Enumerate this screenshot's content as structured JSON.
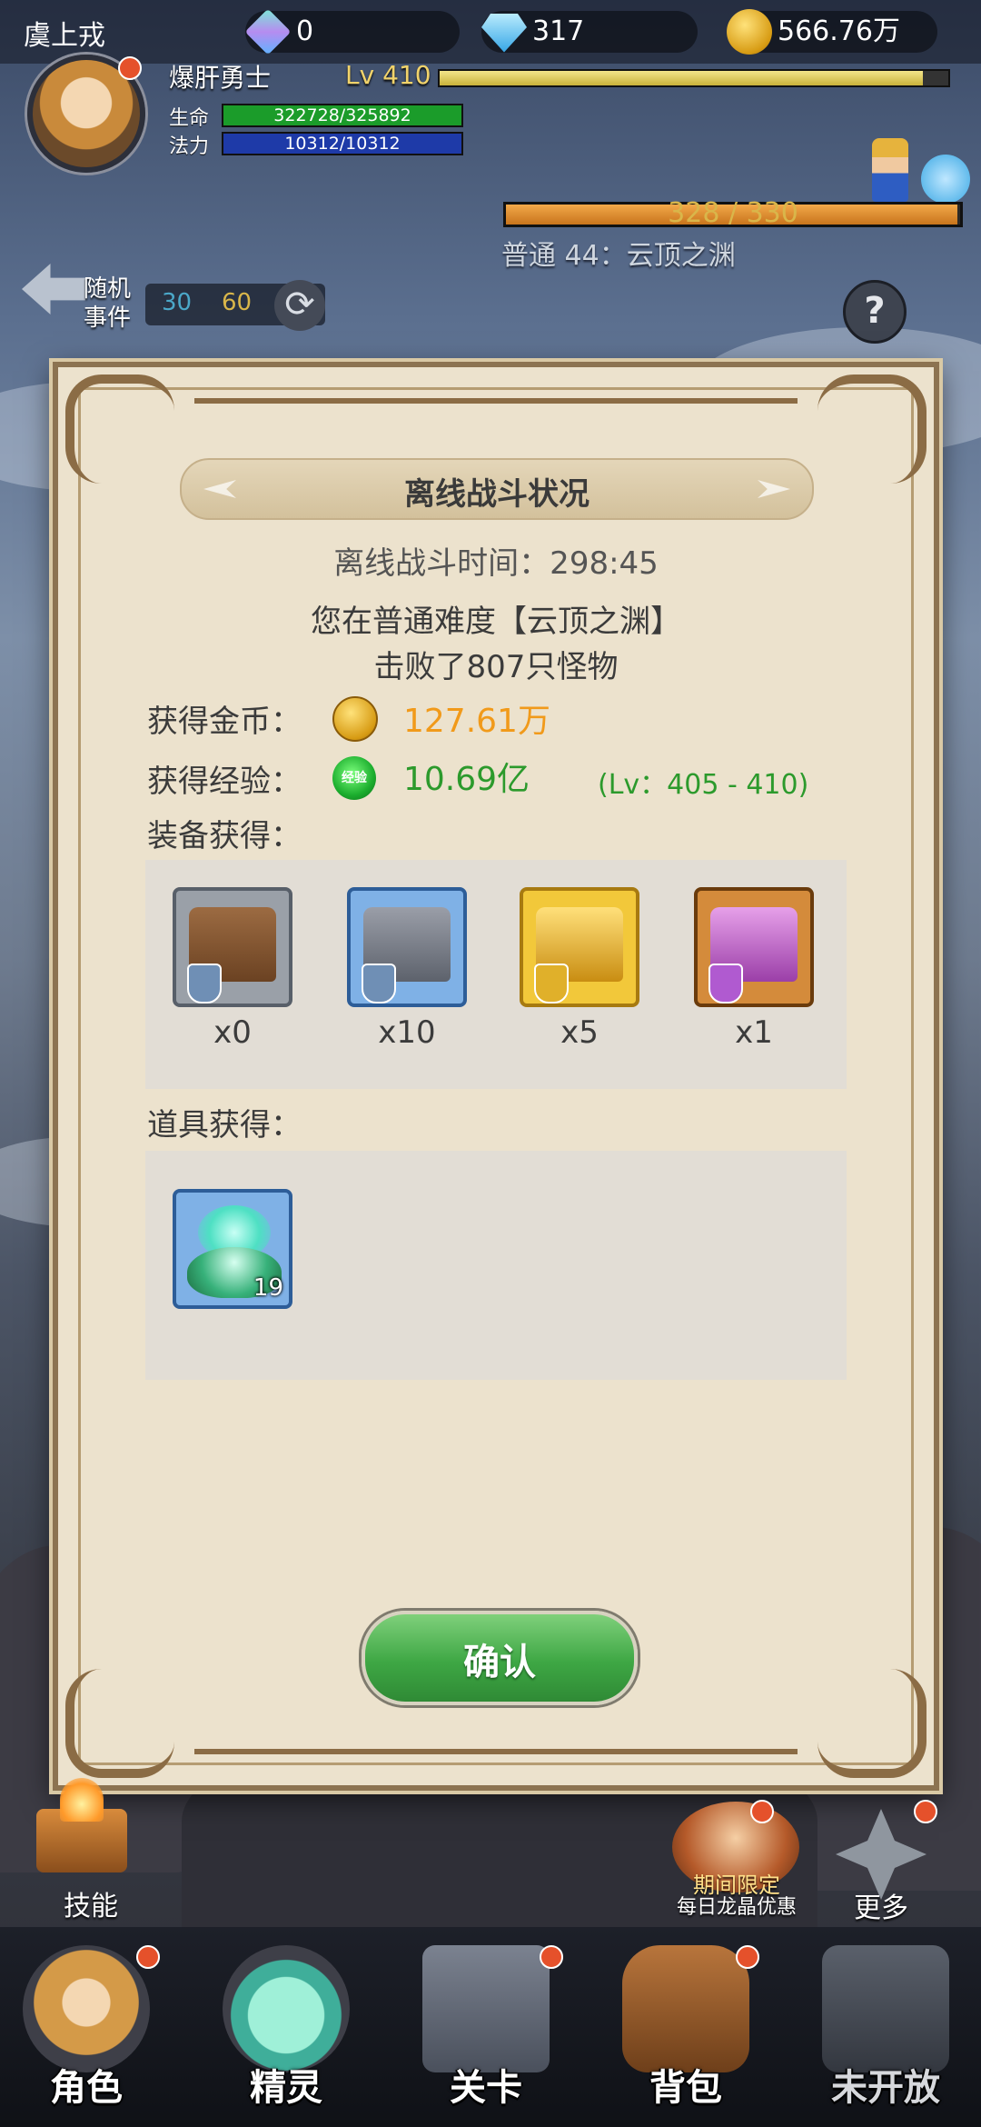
{
  "header": {
    "server_name": "虞上戎",
    "resources": [
      {
        "icon": "gem-cube-icon",
        "value": "0"
      },
      {
        "icon": "diamond-icon",
        "value": "317"
      },
      {
        "icon": "gold-coin-icon",
        "value": "566.76万"
      }
    ]
  },
  "player": {
    "name": "爆肝勇士",
    "level": "Lv 410",
    "hp_label": "生命",
    "hp_value": "322728/325892",
    "mp_label": "法力",
    "mp_value": "10312/10312",
    "xp_fraction": 0.95
  },
  "stage": {
    "progress_text": "328 / 330",
    "progress_fraction": 0.994,
    "name": "普通 44：云顶之渊"
  },
  "random_event": {
    "label_line1": "随机",
    "label_line2": "事件",
    "value_a": "30",
    "value_b": "60"
  },
  "modal": {
    "title": "离线战斗状况",
    "battle_time": "离线战斗时间：298:45",
    "difficulty_line": "您在普通难度【云顶之渊】",
    "defeated_line": "击败了807只怪物",
    "gold_label": "获得金币：",
    "gold_value": "127.61万",
    "exp_label": "获得经验：",
    "exp_badge": "经验",
    "exp_value": "10.69亿",
    "exp_level_range": "(Lv：405 - 410)",
    "equip_label": "装备获得：",
    "equipment": [
      {
        "icon": "bronze-chest-icon",
        "count": "x0"
      },
      {
        "icon": "blue-chest-icon",
        "count": "x10"
      },
      {
        "icon": "gold-chest-icon",
        "count": "x5"
      },
      {
        "icon": "purple-chest-icon",
        "count": "x1"
      }
    ],
    "items_label": "道具获得：",
    "items": [
      {
        "icon": "spirit-flame-leaf-icon",
        "quantity": "19"
      }
    ],
    "confirm_label": "确认"
  },
  "side_buttons": {
    "skill_label": "技能",
    "promo_line1": "期间限定",
    "promo_line2": "每日龙晶优惠",
    "more_label": "更多"
  },
  "nav": [
    {
      "label": "角色",
      "icon": "hero-portrait-icon"
    },
    {
      "label": "精灵",
      "icon": "spirit-slime-icon"
    },
    {
      "label": "关卡",
      "icon": "stage-gate-icon"
    },
    {
      "label": "背包",
      "icon": "backpack-icon"
    },
    {
      "label": "未开放",
      "icon": "locked-gate-icon"
    }
  ]
}
